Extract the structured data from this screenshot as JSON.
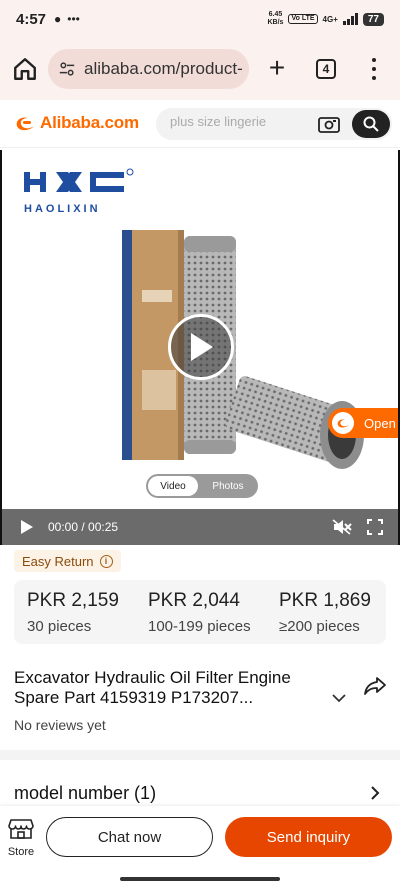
{
  "status_bar": {
    "time": "4:57",
    "net_speed_value": "6.45",
    "net_speed_unit": "KB/s",
    "volte": "Vo LTE",
    "network": "4G+",
    "battery": "77"
  },
  "browser": {
    "url": "alibaba.com/product-",
    "tab_count": "4"
  },
  "site_header": {
    "logo_text": "Alibaba.com",
    "search_placeholder": "plus size lingerie",
    "brand_color": "#ff6a00"
  },
  "media": {
    "brand_name": "HAOLIXIN",
    "brand_logo_text": "HXC",
    "toggle_video": "Video",
    "toggle_photos": "Photos",
    "time_display": "00:00 / 00:25",
    "open_label": "Open"
  },
  "badge": {
    "easy_return": "Easy Return",
    "info_glyph": "i"
  },
  "price_tiers": [
    {
      "price": "PKR 2,159",
      "quantity": "30 pieces"
    },
    {
      "price": "PKR 2,044",
      "quantity": "100-199 pieces"
    },
    {
      "price": "PKR 1,869",
      "quantity": "≥200 pieces"
    }
  ],
  "product": {
    "title": "Excavator Hydraulic Oil Filter Engine Spare Part 4159319 P173207...",
    "reviews": "No reviews yet"
  },
  "attributes": {
    "model_number": "model number (1)"
  },
  "bottom_bar": {
    "store_label": "Store",
    "chat_label": "Chat now",
    "inquiry_label": "Send inquiry",
    "inquiry_color": "#e64600"
  }
}
